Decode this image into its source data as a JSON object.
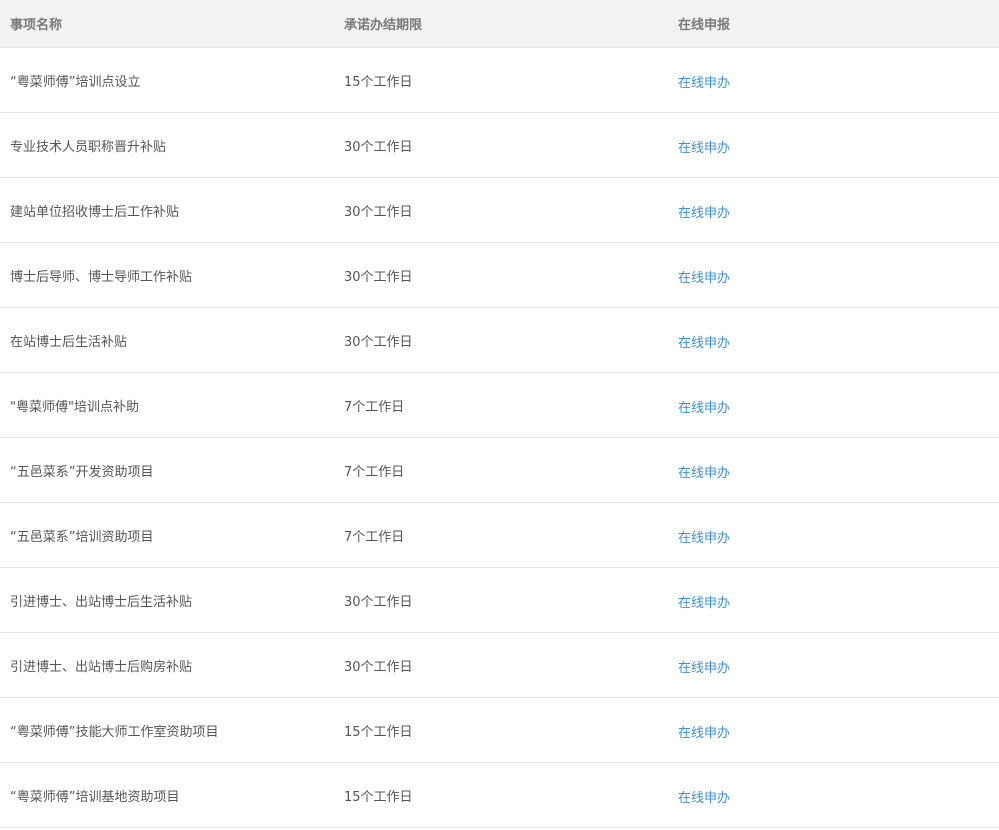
{
  "table": {
    "headers": {
      "name": "事项名称",
      "limit": "承诺办结期限",
      "apply": "在线申报"
    },
    "rows": [
      {
        "name": "“粤菜师傅”培训点设立",
        "limit": "15个工作日",
        "apply": "在线申办"
      },
      {
        "name": "专业技术人员职称晋升补贴",
        "limit": "30个工作日",
        "apply": "在线申办"
      },
      {
        "name": "建站单位招收博士后工作补贴",
        "limit": "30个工作日",
        "apply": "在线申办"
      },
      {
        "name": "博士后导师、博士导师工作补贴",
        "limit": "30个工作日",
        "apply": "在线申办"
      },
      {
        "name": "在站博士后生活补贴",
        "limit": "30个工作日",
        "apply": "在线申办"
      },
      {
        "name": "\"粤菜师傅\"培训点补助",
        "limit": "7个工作日",
        "apply": "在线申办"
      },
      {
        "name": "“五邑菜系”开发资助项目",
        "limit": "7个工作日",
        "apply": "在线申办"
      },
      {
        "name": "“五邑菜系”培训资助项目",
        "limit": "7个工作日",
        "apply": "在线申办"
      },
      {
        "name": "引进博士、出站博士后生活补贴",
        "limit": "30个工作日",
        "apply": "在线申办"
      },
      {
        "name": "引进博士、出站博士后购房补贴",
        "limit": "30个工作日",
        "apply": "在线申办"
      },
      {
        "name": "“粤菜师傅”技能大师工作室资助项目",
        "limit": "15个工作日",
        "apply": "在线申办"
      },
      {
        "name": "“粤菜师傅”培训基地资助项目",
        "limit": "15个工作日",
        "apply": "在线申办"
      }
    ]
  },
  "colors": {
    "header_bg": "#f2f2f2",
    "text": "#555555",
    "link": "#3e8fd6",
    "divider": "#e8e8e8"
  }
}
